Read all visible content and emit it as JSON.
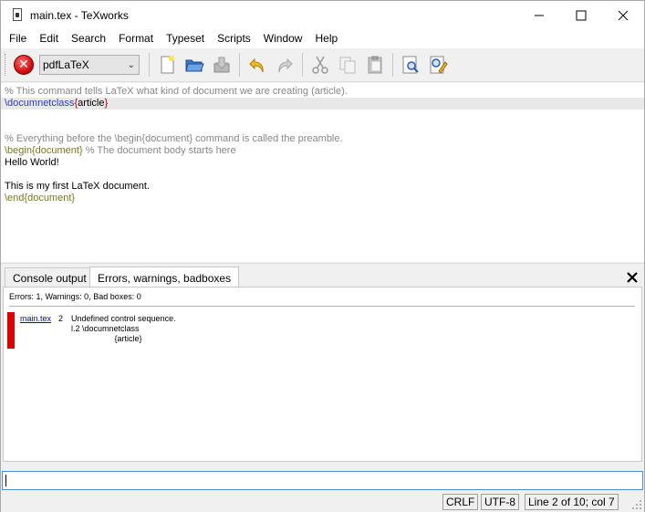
{
  "window": {
    "title": "main.tex - TeXworks",
    "minimize_glyph": "—",
    "maximize_glyph": "☐",
    "close_glyph": "✕"
  },
  "menu": [
    "File",
    "Edit",
    "Search",
    "Format",
    "Typeset",
    "Scripts",
    "Window",
    "Help"
  ],
  "toolbar": {
    "typeset_icon": "stop-typeset-icon",
    "typeset_glyph": "✕",
    "engine": "pdfLaTeX",
    "buttons": [
      "new-document-icon",
      "open-folder-icon",
      "save-icon",
      "undo-icon",
      "redo-icon",
      "cut-icon",
      "copy-icon",
      "paste-icon",
      "find-icon",
      "replace-icon"
    ]
  },
  "editor": {
    "line1": "% This command tells LaTeX what kind of document we are creating (article).",
    "line2_cmd": "\\documnetclass",
    "line2_open": "{",
    "line2_arg": "article",
    "line2_close": "}",
    "line3": "",
    "line4": "",
    "line5": "% Everything before the \\begin{document} command is called the preamble.",
    "line6_cmd": "\\begin{document}",
    "line6_comment": " % The document body starts here",
    "line7": "Hello World!",
    "line8": "",
    "line9": "This is my first LaTeX document.",
    "line10": "\\end{document}"
  },
  "panel": {
    "tab_console": "Console output",
    "tab_errors": "Errors, warnings, badboxes",
    "close_glyph": "✕",
    "summary": "Errors: 1, Warnings: 0, Bad boxes: 0",
    "error_file": "main.tex",
    "error_line": "2",
    "error_message": "Undefined control sequence.\nl.2 \\documnetclass\n                   {article}"
  },
  "statusbar": {
    "line_ending": "CRLF",
    "encoding": "UTF-8",
    "position": "Line 2 of 10; col 7"
  },
  "colors": {
    "error_marker": "#e00000",
    "comment": "#888888",
    "command": "#2a3fbf",
    "brace": "#c00000",
    "environment": "#7a7a1a"
  }
}
